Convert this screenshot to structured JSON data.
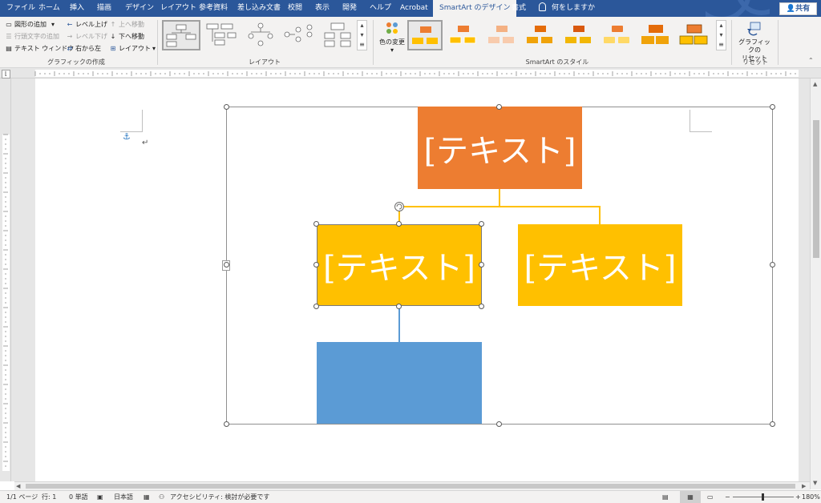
{
  "tabs": [
    {
      "label": "ファイル",
      "name": "tab-file"
    },
    {
      "label": "ホーム",
      "name": "tab-home"
    },
    {
      "label": "挿入",
      "name": "tab-insert"
    },
    {
      "label": "描画",
      "name": "tab-draw"
    },
    {
      "label": "デザイン",
      "name": "tab-design"
    },
    {
      "label": "レイアウト",
      "name": "tab-layout"
    },
    {
      "label": "参考資料",
      "name": "tab-references"
    },
    {
      "label": "差し込み文書",
      "name": "tab-mailings"
    },
    {
      "label": "校閲",
      "name": "tab-review"
    },
    {
      "label": "表示",
      "name": "tab-view"
    },
    {
      "label": "開発",
      "name": "tab-developer"
    },
    {
      "label": "ヘルプ",
      "name": "tab-help"
    },
    {
      "label": "Acrobat",
      "name": "tab-acrobat"
    },
    {
      "label": "SmartArt のデザイン",
      "name": "tab-smartart-design"
    },
    {
      "label": "書式",
      "name": "tab-format"
    }
  ],
  "tell_me": "何をしますか",
  "share_label": "共有",
  "ribbon": {
    "create_graphic": {
      "add_shape": "図形の追加",
      "add_bullet": "行頭文字の追加",
      "text_pane": "テキスト ウィンドウ",
      "promote": "レベル上げ",
      "demote": "レベル下げ",
      "right_to_left": "右から左",
      "move_up": "上へ移動",
      "move_down": "下へ移動",
      "layout": "レイアウト",
      "label": "グラフィックの作成"
    },
    "layouts_label": "レイアウト",
    "change_colors": "色の変更",
    "styles_label": "SmartArt のスタイル",
    "reset": {
      "line1": "グラフィックの",
      "line2": "リセット",
      "label": "リセット"
    }
  },
  "smartart": {
    "top_text": "[テキスト]",
    "left_text": "[テキスト]",
    "right_text": "[テキスト]"
  },
  "status": {
    "page": "1/1 ページ",
    "line": "行: 1",
    "words": "0 単語",
    "language": "日本語",
    "accessibility": "アクセシビリティ: 検討が必要です",
    "zoom": "180%"
  },
  "colors": {
    "tab_bar": "#2b579a",
    "node_top": "#ed7d31",
    "node_mid": "#ffc000",
    "node_bottom": "#5b9bd5"
  }
}
